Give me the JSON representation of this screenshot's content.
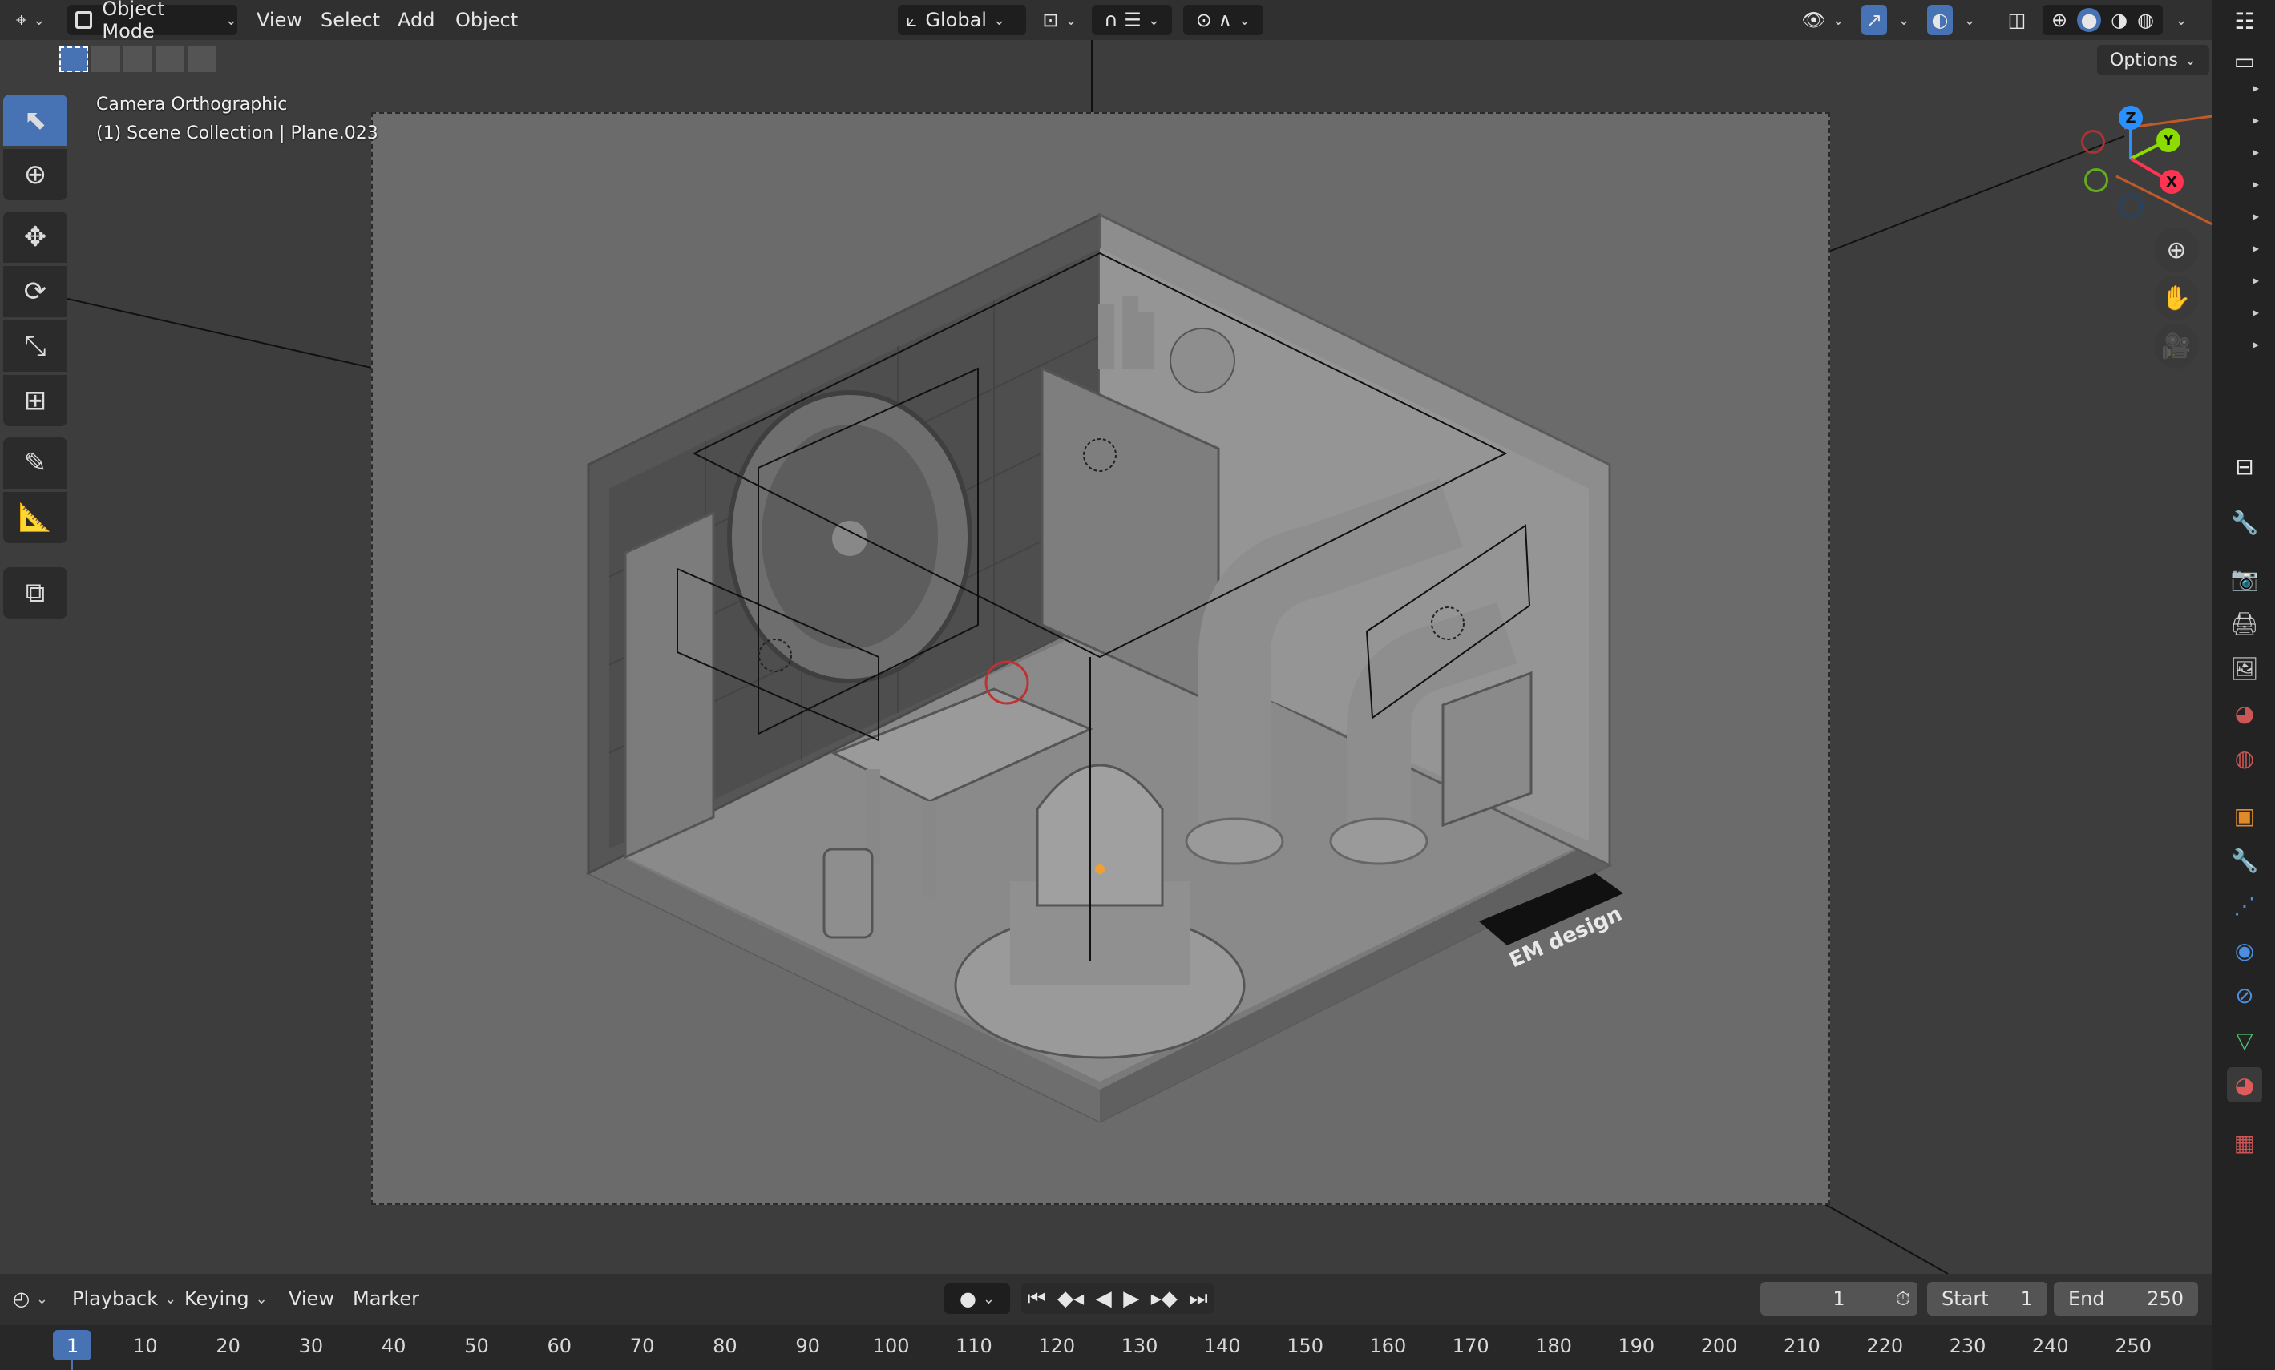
{
  "header": {
    "mode": "Object Mode",
    "menus": [
      "View",
      "Select",
      "Add",
      "Object"
    ],
    "transform_orientation": "Global",
    "options_label": "Options"
  },
  "viewport": {
    "view_name": "Camera Orthographic",
    "collection_info": "(1) Scene Collection | Plane.023",
    "watermark": "EM design"
  },
  "gizmo": {
    "axes": [
      "Z",
      "Y",
      "X"
    ]
  },
  "toolbar": {
    "tools": [
      "select-box",
      "cursor",
      "move",
      "rotate",
      "scale",
      "transform",
      "annotate",
      "measure",
      "add-cube"
    ],
    "active": "select-box"
  },
  "timeline": {
    "menus": [
      "Playback",
      "Keying",
      "View",
      "Marker"
    ],
    "current_frame": "1",
    "start_label": "Start",
    "start_value": "1",
    "end_label": "End",
    "end_value": "250",
    "ruler": [
      "1",
      "10",
      "20",
      "30",
      "40",
      "50",
      "60",
      "70",
      "80",
      "90",
      "100",
      "110",
      "120",
      "130",
      "140",
      "150",
      "160",
      "170",
      "180",
      "190",
      "200",
      "210",
      "220",
      "230",
      "240",
      "250"
    ]
  },
  "colors": {
    "accent": "#4772b3",
    "axis_x": "#ff3352",
    "axis_y": "#8bdc00",
    "axis_z": "#2890ff",
    "viewport_bg": "#3d3d3d",
    "camera_bg": "#6b6b6b"
  }
}
